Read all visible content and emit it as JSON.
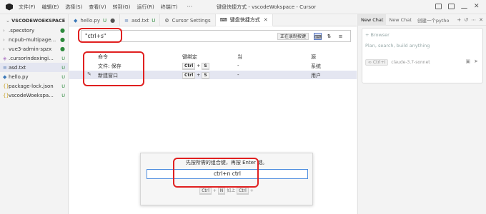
{
  "titlebar": {
    "menus": [
      "文件(F)",
      "编辑(E)",
      "选择(S)",
      "查看(V)",
      "转到(G)",
      "运行(R)",
      "终端(T)"
    ],
    "more": "···",
    "title": "键盘快捷方式 - vscodeWokspace - Cursor"
  },
  "sidebar": {
    "workspace": "VSCODEWOEKSPACE",
    "items": [
      {
        "name": ".specstory",
        "status": "●",
        "chevron": "›"
      },
      {
        "name": "ncpub-multipage...",
        "status": "●",
        "chevron": "›"
      },
      {
        "name": "vue3-admin-spzx",
        "status": "●",
        "chevron": "›"
      },
      {
        "name": ".cursorindexingi...",
        "status": "U",
        "icon": "◈"
      },
      {
        "name": "asd.txt",
        "status": "U",
        "icon": "≡"
      },
      {
        "name": "hello.py",
        "status": "U",
        "icon": "◆"
      },
      {
        "name": "package-lock.json",
        "status": "U",
        "icon": "{}"
      },
      {
        "name": "vscodeWoekspa...",
        "status": "U",
        "icon": "{}"
      }
    ]
  },
  "tabs": [
    {
      "label": "hello.py",
      "status": "U",
      "icon": "◆"
    },
    {
      "label": "asd.txt",
      "status": "U",
      "icon": "≡"
    },
    {
      "label": "Cursor Settings",
      "icon": "⚙"
    },
    {
      "label": "键盘快捷方式",
      "icon": "⌨"
    }
  ],
  "keybindings": {
    "search_value": "\"ctrl+s\"",
    "recording_label": "正在录制按键",
    "headers": {
      "command": "命令",
      "keybinding": "键绑定",
      "when": "当",
      "source": "源"
    },
    "rows": [
      {
        "command": "文件: 保存",
        "key1": "Ctrl",
        "key2": "S",
        "when": "-",
        "source": "系统"
      },
      {
        "command": "新建窗口",
        "key1": "Ctrl",
        "key2": "S",
        "when": "-",
        "source": "用户"
      }
    ],
    "plus": "+"
  },
  "dialog": {
    "message": "先按所需的组合键，再按 Enter 键。",
    "input_value": "ctrl+n ctrl",
    "existing_key1": "Ctrl",
    "existing_plus": "+",
    "existing_key2": "N",
    "existing_mid": "如上",
    "existing_key3": "Ctrl",
    "existing_plus2": "+"
  },
  "chat": {
    "tabs": [
      "New Chat",
      "New Chat",
      "创建一个pytho"
    ],
    "browser_chip": "+ Browser",
    "placeholder": "Plan, search, build anything",
    "mode": "∞ Ctrl+I",
    "model": "claude-3.7-sonnet"
  },
  "colors": {
    "annotation": "#e02020",
    "accent": "#4f8ee0"
  }
}
